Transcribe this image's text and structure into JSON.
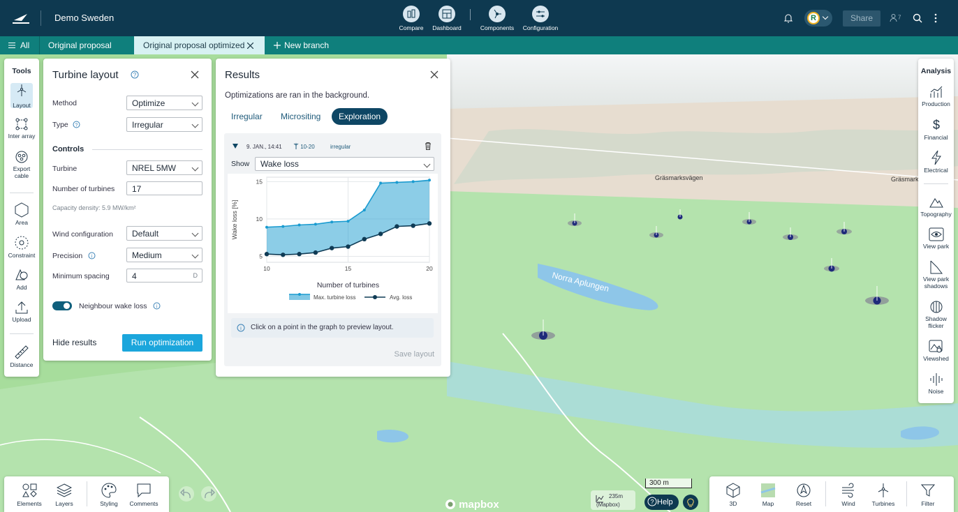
{
  "header": {
    "project": "Demo Sweden",
    "nav": [
      {
        "label": "Compare",
        "icon": "compare-icon"
      },
      {
        "label": "Dashboard",
        "icon": "dashboard-icon"
      },
      {
        "label": "Components",
        "icon": "components-icon"
      },
      {
        "label": "Configuration",
        "icon": "configuration-icon"
      }
    ],
    "share": "Share",
    "user_count": "7",
    "avatar_letter": "R"
  },
  "tabs": {
    "all": "All",
    "items": [
      "Original proposal",
      "Original proposal optimized"
    ],
    "new_branch": "New branch"
  },
  "tools": {
    "title": "Tools",
    "items": [
      "Layout",
      "Inter array",
      "Export cable",
      "Area",
      "Constraint",
      "Add",
      "Upload",
      "Distance"
    ]
  },
  "turbine_layout": {
    "title": "Turbine layout",
    "method_label": "Method",
    "method": "Optimize",
    "type_label": "Type",
    "type": "Irregular",
    "controls": "Controls",
    "turbine_label": "Turbine",
    "turbine": "NREL 5MW",
    "num_label": "Number of turbines",
    "num": "17",
    "capacity": "Capacity density: 5.9 MW/km²",
    "wind_label": "Wind configuration",
    "wind": "Default",
    "precision_label": "Precision",
    "precision": "Medium",
    "spacing_label": "Minimum spacing",
    "spacing": "4",
    "spacing_unit": "D",
    "neighbour": "Neighbour wake loss",
    "neighbour_on": true,
    "hide": "Hide results",
    "run": "Run optimization"
  },
  "results": {
    "title": "Results",
    "note": "Optimizations are ran in the background.",
    "tabs": [
      "Irregular",
      "Micrositing",
      "Exploration"
    ],
    "active_tab": "Exploration",
    "run_date": "9. JAN., 14:41",
    "run_range": "10-20",
    "run_type": "irregular",
    "show_label": "Show",
    "show": "Wake loss",
    "info": "Click on a point in the graph to preview layout.",
    "save": "Save layout"
  },
  "chart_data": {
    "type": "area",
    "x": [
      10,
      11,
      12,
      13,
      14,
      15,
      16,
      17,
      18,
      19,
      20
    ],
    "series": [
      {
        "name": "Max. turbine loss",
        "values": [
          8.9,
          9.0,
          9.2,
          9.3,
          9.6,
          9.7,
          11.2,
          14.8,
          14.9,
          15.0,
          15.2
        ]
      },
      {
        "name": "Avg. loss",
        "values": [
          5.3,
          5.2,
          5.3,
          5.5,
          6.1,
          6.3,
          7.3,
          8.0,
          9.0,
          9.1,
          9.4
        ]
      }
    ],
    "xlabel": "Number of turbines",
    "ylabel": "Wake loss [%]",
    "xlim": [
      10,
      20
    ],
    "ylim": [
      4.2,
      15.6
    ],
    "xticks": [
      10,
      15,
      20
    ],
    "yticks": [
      5,
      10,
      15
    ],
    "grid": true,
    "legend": "bottom"
  },
  "analysis": {
    "title": "Analysis",
    "items": [
      "Production",
      "Financial",
      "Electrical",
      "Topography",
      "View park",
      "View park shadows",
      "Shadow flicker",
      "Viewshed",
      "Noise"
    ]
  },
  "bottom_left": [
    "Elements",
    "Layers",
    "Styling",
    "Comments"
  ],
  "bottom_right": [
    "3D",
    "Map",
    "Reset",
    "Wind",
    "Turbines",
    "Filter"
  ],
  "map": {
    "place1": "Gräsmarksvägen",
    "place2": "Gräsmarksv",
    "lake": "Norra Aplungen",
    "scale": "300 m",
    "elevation": "235m",
    "elevation_src": "(Mapbox)",
    "help": "Help",
    "brand": "mapbox"
  },
  "colors": {
    "header": "#0e3950",
    "tabbar": "#0f7f7c",
    "active_tab": "#d7f1f3",
    "accent": "#1ba6dc",
    "max_series": "#1a9bd0",
    "avg_series": "#0f3b55"
  }
}
